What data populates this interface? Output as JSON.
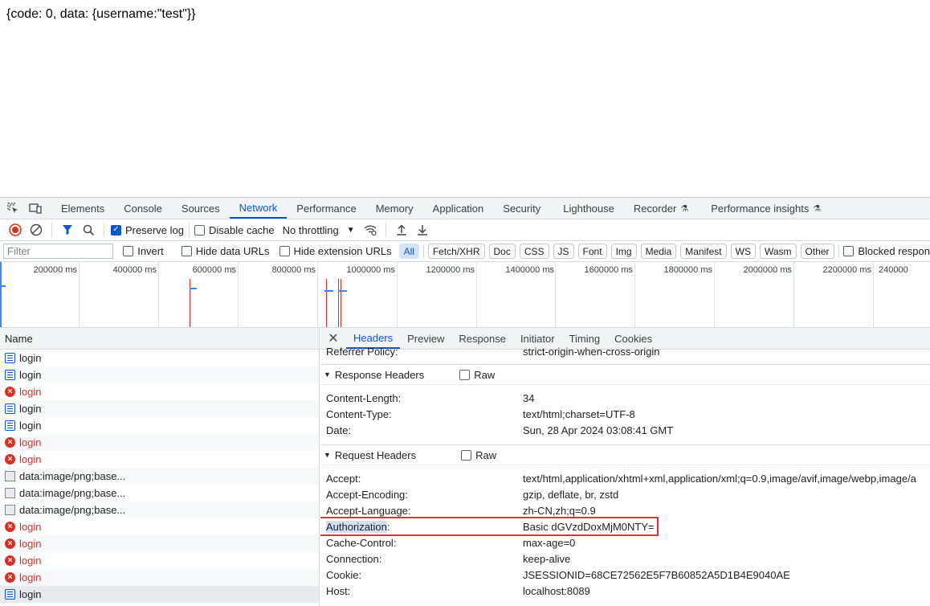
{
  "page": {
    "response_text": "{code: 0, data: {username:\"test\"}}"
  },
  "devtools": {
    "main_tabs": [
      {
        "label": "Elements"
      },
      {
        "label": "Console"
      },
      {
        "label": "Sources"
      },
      {
        "label": "Network",
        "active": true
      },
      {
        "label": "Performance"
      },
      {
        "label": "Memory"
      },
      {
        "label": "Application"
      },
      {
        "label": "Security"
      },
      {
        "label": "Lighthouse"
      },
      {
        "label": "Recorder"
      },
      {
        "label": "Performance insights"
      }
    ],
    "toolbar": {
      "preserve_log": "Preserve log",
      "disable_cache": "Disable cache",
      "throttling": "No throttling"
    },
    "filterbar": {
      "placeholder": "Filter",
      "invert": "Invert",
      "hide_data_urls": "Hide data URLs",
      "hide_extension_urls": "Hide extension URLs",
      "types": [
        "All",
        "Fetch/XHR",
        "Doc",
        "CSS",
        "JS",
        "Font",
        "Img",
        "Media",
        "Manifest",
        "WS",
        "Wasm",
        "Other"
      ],
      "blocked": "Blocked respon"
    },
    "overview": {
      "ticks": [
        "200000 ms",
        "400000 ms",
        "600000 ms",
        "800000 ms",
        "1000000 ms",
        "1200000 ms",
        "1400000 ms",
        "1600000 ms",
        "1800000 ms",
        "2000000 ms",
        "2200000 ms",
        "240000"
      ]
    },
    "request_list": {
      "header": "Name",
      "rows": [
        {
          "name": "login",
          "kind": "doc"
        },
        {
          "name": "login",
          "kind": "doc"
        },
        {
          "name": "login",
          "kind": "error"
        },
        {
          "name": "login",
          "kind": "doc"
        },
        {
          "name": "login",
          "kind": "doc"
        },
        {
          "name": "login",
          "kind": "error"
        },
        {
          "name": "login",
          "kind": "error"
        },
        {
          "name": "data:image/png;base...",
          "kind": "image"
        },
        {
          "name": "data:image/png;base...",
          "kind": "image"
        },
        {
          "name": "data:image/png;base...",
          "kind": "image"
        },
        {
          "name": "login",
          "kind": "error"
        },
        {
          "name": "login",
          "kind": "error"
        },
        {
          "name": "login",
          "kind": "error"
        },
        {
          "name": "login",
          "kind": "error"
        },
        {
          "name": "login",
          "kind": "doc",
          "selected": true
        }
      ]
    },
    "detail": {
      "tabs": [
        "Headers",
        "Preview",
        "Response",
        "Initiator",
        "Timing",
        "Cookies"
      ],
      "referrer": {
        "key": "Referrer Policy:",
        "value": "strict-origin-when-cross-origin"
      },
      "response_section": {
        "title": "Response Headers",
        "raw": "Raw"
      },
      "response_headers": [
        {
          "key": "Content-Length:",
          "value": "34"
        },
        {
          "key": "Content-Type:",
          "value": "text/html;charset=UTF-8"
        },
        {
          "key": "Date:",
          "value": "Sun, 28 Apr 2024 03:08:41 GMT"
        }
      ],
      "request_section": {
        "title": "Request Headers",
        "raw": "Raw"
      },
      "request_headers": [
        {
          "key": "Accept:",
          "value": "text/html,application/xhtml+xml,application/xml;q=0.9,image/avif,image/webp,image/a"
        },
        {
          "key": "Accept-Encoding:",
          "value": "gzip, deflate, br, zstd"
        },
        {
          "key": "Accept-Language:",
          "value": "zh-CN,zh;q=0.9"
        },
        {
          "key": "Authorization",
          "value": "Basic dGVzdDoxMjM0NTY="
        },
        {
          "key": "Cache-Control:",
          "value": "max-age=0"
        },
        {
          "key": "Connection:",
          "value": "keep-alive"
        },
        {
          "key": "Cookie:",
          "value": "JSESSIONID=68CE72562E5F7B60852A5D1B4E9040AE"
        },
        {
          "key": "Host:",
          "value": "localhost:8089"
        }
      ]
    }
  }
}
